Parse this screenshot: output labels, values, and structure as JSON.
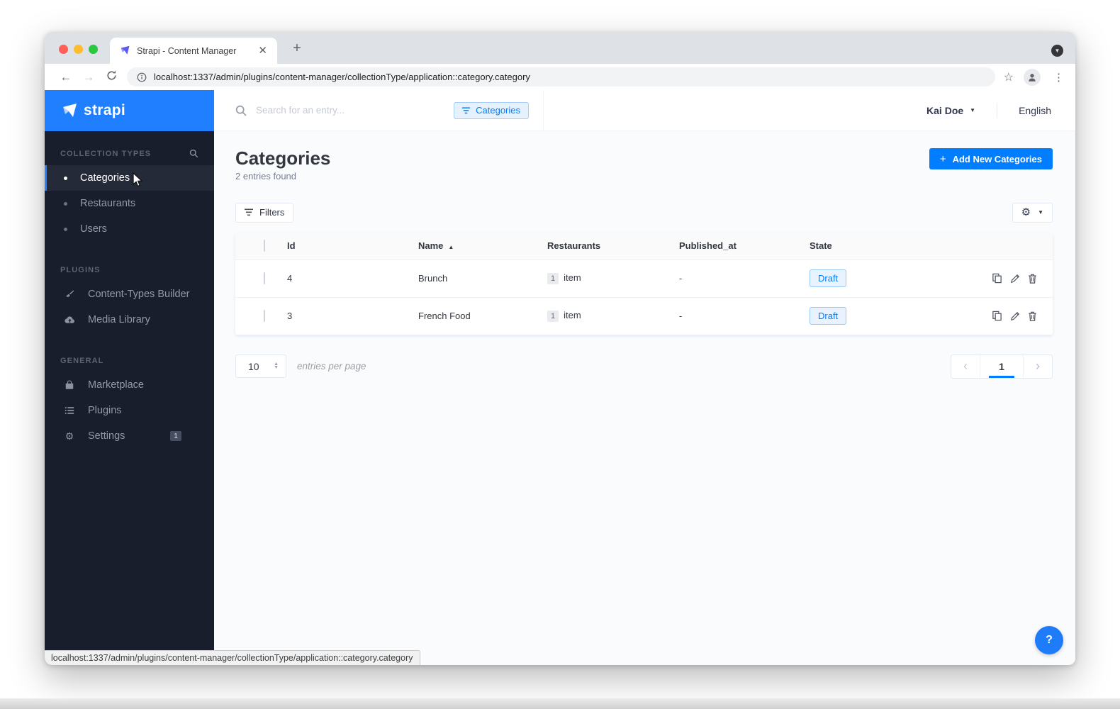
{
  "browser": {
    "tab_title": "Strapi - Content Manager",
    "url": "localhost:1337/admin/plugins/content-manager/collectionType/application::category.category",
    "status_url": "localhost:1337/admin/plugins/content-manager/collectionType/application::category.category"
  },
  "sidebar": {
    "logo": "strapi",
    "collection_types": {
      "title": "COLLECTION TYPES",
      "items": [
        "Categories",
        "Restaurants",
        "Users"
      ]
    },
    "plugins_section": {
      "title": "PLUGINS",
      "items": [
        "Content-Types Builder",
        "Media Library"
      ]
    },
    "general_section": {
      "title": "GENERAL",
      "items": [
        "Marketplace",
        "Plugins",
        "Settings"
      ],
      "settings_badge": "1"
    }
  },
  "header": {
    "search_placeholder": "Search for an entry...",
    "filter_chip": "Categories",
    "user": "Kai Doe",
    "language": "English"
  },
  "content": {
    "title": "Categories",
    "entries_found": "2 entries found",
    "add_button": "Add New Categories",
    "filters_button": "Filters",
    "table": {
      "headers": {
        "id": "Id",
        "name": "Name",
        "restaurants": "Restaurants",
        "published_at": "Published_at",
        "state": "State"
      },
      "rows": [
        {
          "id": "4",
          "name": "Brunch",
          "restaurants_count": "1",
          "restaurants_unit": "item",
          "published_at": "-",
          "state": "Draft"
        },
        {
          "id": "3",
          "name": "French Food",
          "restaurants_count": "1",
          "restaurants_unit": "item",
          "published_at": "-",
          "state": "Draft"
        }
      ]
    },
    "pagination": {
      "page_size": "10",
      "label": "entries per page",
      "page": "1"
    }
  },
  "colors": {
    "primary_blue": "#007eff",
    "sidebar_bg": "#181e2c",
    "logo_header_bg": "#1f7fff",
    "draft_badge_bg": "#e9f3ff",
    "draft_badge_text": "#007eff"
  }
}
